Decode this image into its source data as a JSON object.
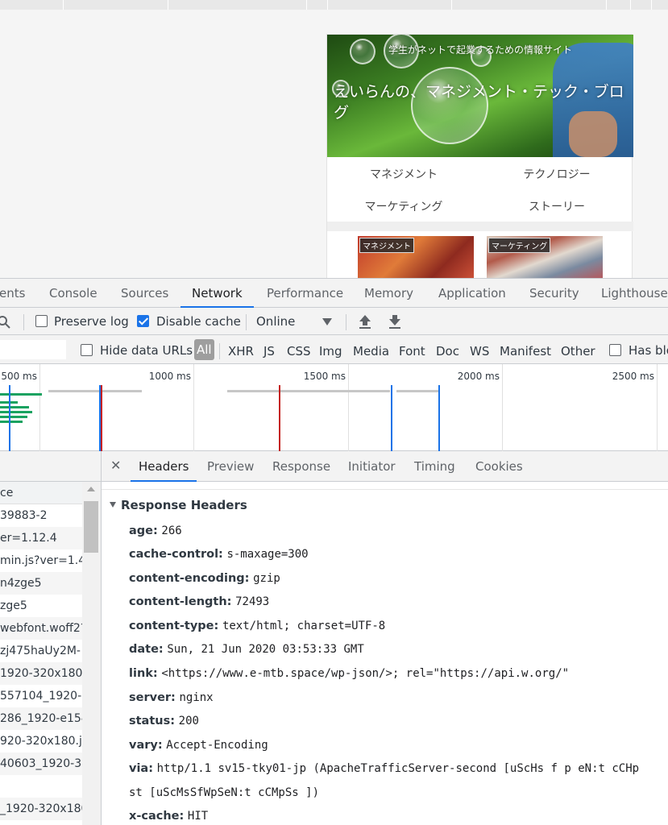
{
  "page": {
    "subtitle": "学生がネットで起業するための情報サイト",
    "title": "えいらんの、マネジメント・テック・ブログ",
    "nav": [
      "マネジメント",
      "テクノロジー",
      "マーケティング",
      "ストーリー"
    ],
    "card_tags": [
      "マネジメント",
      "マーケティング"
    ]
  },
  "devtools": {
    "tabs": [
      "ents",
      "Console",
      "Sources",
      "Network",
      "Performance",
      "Memory",
      "Application",
      "Security",
      "Lighthouse"
    ],
    "active_tab": "Network",
    "toolbar": {
      "preserve_log": "Preserve log",
      "disable_cache": "Disable cache",
      "throttle": "Online",
      "preserve_log_checked": false,
      "disable_cache_checked": true
    },
    "filters": {
      "hide_data_urls": "Hide data URLs",
      "all": "All",
      "types": [
        "XHR",
        "JS",
        "CSS",
        "Img",
        "Media",
        "Font",
        "Doc",
        "WS",
        "Manifest",
        "Other"
      ],
      "has_blocked": "Has blo"
    },
    "timeline": {
      "ticks": [
        "500 ms",
        "1000 ms",
        "1500 ms",
        "2000 ms",
        "2500 ms"
      ]
    },
    "requests": {
      "column": "ce",
      "rows": [
        "39883-2",
        "er=1.12.4",
        "min.js?ver=1.4",
        "n4zge5",
        "zge5",
        "webfont.woff2?",
        "zj475haUy2M-",
        "1920-320x180.",
        "557104_1920-.",
        "286_1920-e154",
        "920-320x180.j",
        "40603_1920-32",
        "",
        "_1920-320x180"
      ]
    },
    "detail": {
      "tabs": [
        "Headers",
        "Preview",
        "Response",
        "Initiator",
        "Timing",
        "Cookies"
      ],
      "active_tab": "Headers",
      "section": "Response Headers",
      "headers": [
        {
          "name": "age:",
          "value": "266"
        },
        {
          "name": "cache-control:",
          "value": "s-maxage=300"
        },
        {
          "name": "content-encoding:",
          "value": "gzip"
        },
        {
          "name": "content-length:",
          "value": "72493"
        },
        {
          "name": "content-type:",
          "value": "text/html; charset=UTF-8"
        },
        {
          "name": "date:",
          "value": "Sun, 21 Jun 2020 03:53:33 GMT"
        },
        {
          "name": "link:",
          "value": "<https://www.e-mtb.space/wp-json/>; rel=\"https://api.w.org/\""
        },
        {
          "name": "server:",
          "value": "nginx"
        },
        {
          "name": "status:",
          "value": "200"
        },
        {
          "name": "vary:",
          "value": "Accept-Encoding"
        },
        {
          "name": "via:",
          "value": "http/1.1 sv15-tky01-jp (ApacheTrafficServer-second [uScHs f p eN:t cCHp"
        },
        {
          "name": "",
          "value": "st [uScMsSfWpSeN:t cCMpSs ])"
        },
        {
          "name": "x-cache:",
          "value": "HIT"
        }
      ]
    }
  },
  "colors": {
    "accent": "#1a73e8",
    "red_marker": "#c5221f",
    "blue_marker": "#1a73e8",
    "green_bar": "#1aa260"
  }
}
